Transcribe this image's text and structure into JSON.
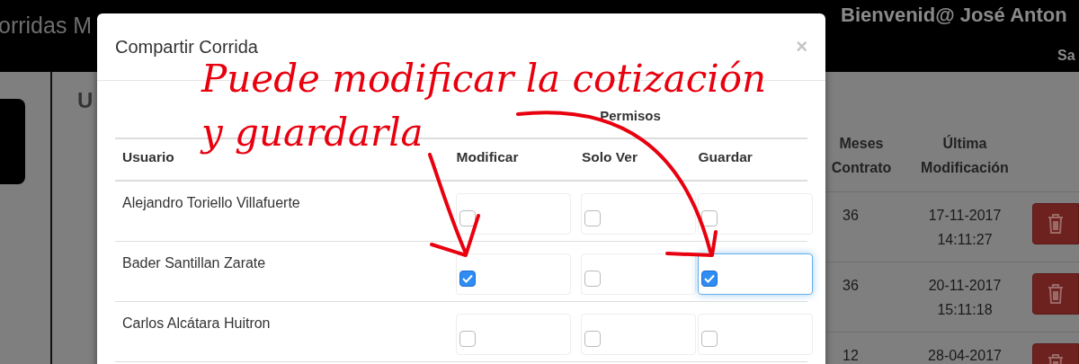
{
  "navbar": {
    "brand": "orridas M",
    "welcome": "Bienvenid@ José Anton",
    "link": "Sa"
  },
  "background": {
    "heading": "U",
    "columns": [
      "Meses Contrato",
      "Última Modificación"
    ],
    "rows": [
      {
        "months": "36",
        "date": "17-11-2017",
        "time": "14:11:27"
      },
      {
        "months": "36",
        "date": "20-11-2017",
        "time": "15:11:18"
      },
      {
        "months": "12",
        "date": "28-04-2017"
      }
    ]
  },
  "modal": {
    "title": "Compartir Corrida",
    "close": "×",
    "group_header": "Permisos",
    "columns": [
      "Usuario",
      "Modificar",
      "Solo Ver",
      "Guardar"
    ],
    "rows": [
      {
        "user": "Alejandro Toriello Villafuerte",
        "permissions": [
          {
            "checked": false,
            "focused": false
          },
          {
            "checked": false,
            "focused": false
          },
          {
            "checked": false,
            "focused": false
          }
        ]
      },
      {
        "user": "Bader Santillan Zarate",
        "permissions": [
          {
            "checked": true,
            "focused": false
          },
          {
            "checked": false,
            "focused": false
          },
          {
            "checked": true,
            "focused": true
          }
        ]
      },
      {
        "user": "Carlos Alcátara Huitron",
        "permissions": [
          {
            "checked": false,
            "focused": false
          },
          {
            "checked": false,
            "focused": false
          },
          {
            "checked": false,
            "focused": false
          }
        ]
      }
    ]
  },
  "annotation": {
    "lines": [
      "Puede modificar la cotización",
      "y guardarla"
    ]
  }
}
